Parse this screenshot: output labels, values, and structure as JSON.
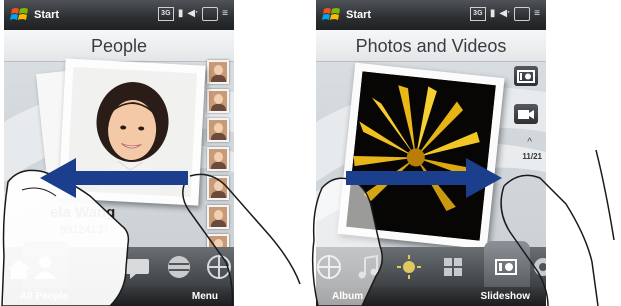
{
  "left_screen": {
    "status_bar": {
      "start_label": "Start",
      "network_label": "3G"
    },
    "header_title": "People",
    "contact": {
      "name": "ela Wang",
      "number": "89124137"
    },
    "softkeys": {
      "left": "All People",
      "right": "Menu"
    },
    "tabs": [
      "home-icon",
      "people-icon",
      "messaging-icon",
      "internet-icon",
      "browser-icon"
    ],
    "thumbnails_count": 7
  },
  "right_screen": {
    "status_bar": {
      "start_label": "Start",
      "network_label": "3G"
    },
    "header_title": "Photos and Videos",
    "counter_label": "11/21",
    "softkeys": {
      "left": "Album",
      "right": "Slideshow"
    },
    "tabs": [
      "globe-icon",
      "music-icon",
      "weather-icon",
      "grid-icon",
      "camera-icon",
      "settings-icon"
    ]
  },
  "gesture": {
    "left_direction": "swipe-left",
    "right_direction": "swipe-right",
    "arrow_color": "#1b3f8c"
  },
  "colors": {
    "title_bar": "#2c2f32",
    "header_bg": "#eef0f2",
    "tab_bar": "#4e5357"
  }
}
